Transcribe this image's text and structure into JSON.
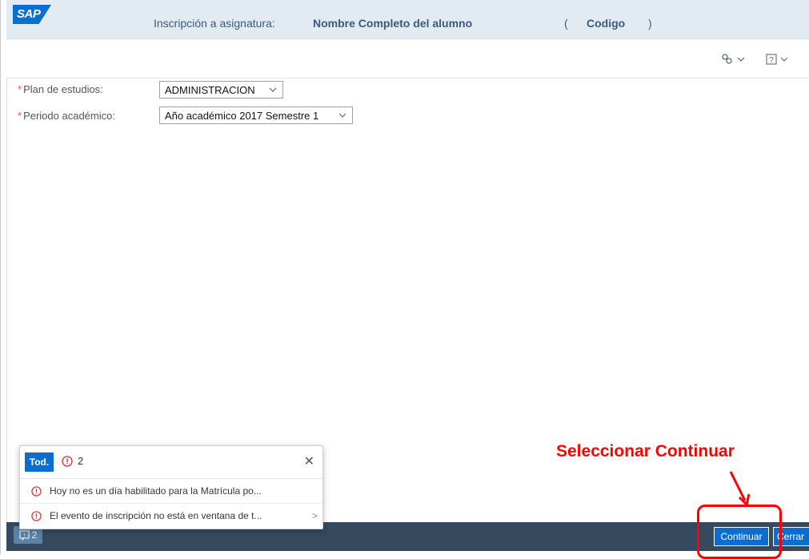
{
  "header": {
    "logo": "SAP",
    "title": "Inscripción a asignatura:",
    "student_name": "Nombre Completo del alumno",
    "paren_open": "(",
    "code": "Codigo",
    "paren_close": ")"
  },
  "toolbar": {
    "settings_icon": "gear-icon",
    "help_icon": "help-icon"
  },
  "form": {
    "plan_label": "Plan de estudios:",
    "plan_value": "ADMINISTRACION",
    "period_label": "Periodo académico:",
    "period_value": "Año académico 2017 Semestre 1",
    "required_marker": "*"
  },
  "messages": {
    "tab_all": "Tod.",
    "error_count": "2",
    "items": [
      {
        "text": "Hoy no es un día habilitado para la Matrícula po..."
      },
      {
        "text": "El evento de inscripción no está en ventana de t..."
      }
    ]
  },
  "footer": {
    "message_count": "2",
    "continue_label": "Continuar",
    "close_label": "Cerrar"
  },
  "annotation": {
    "label": "Seleccionar Continuar"
  },
  "colors": {
    "accent": "#0a6ed1",
    "header_bg": "#e3ebf2",
    "footer_bg": "#354a5f",
    "annotation": "#ff0000"
  }
}
